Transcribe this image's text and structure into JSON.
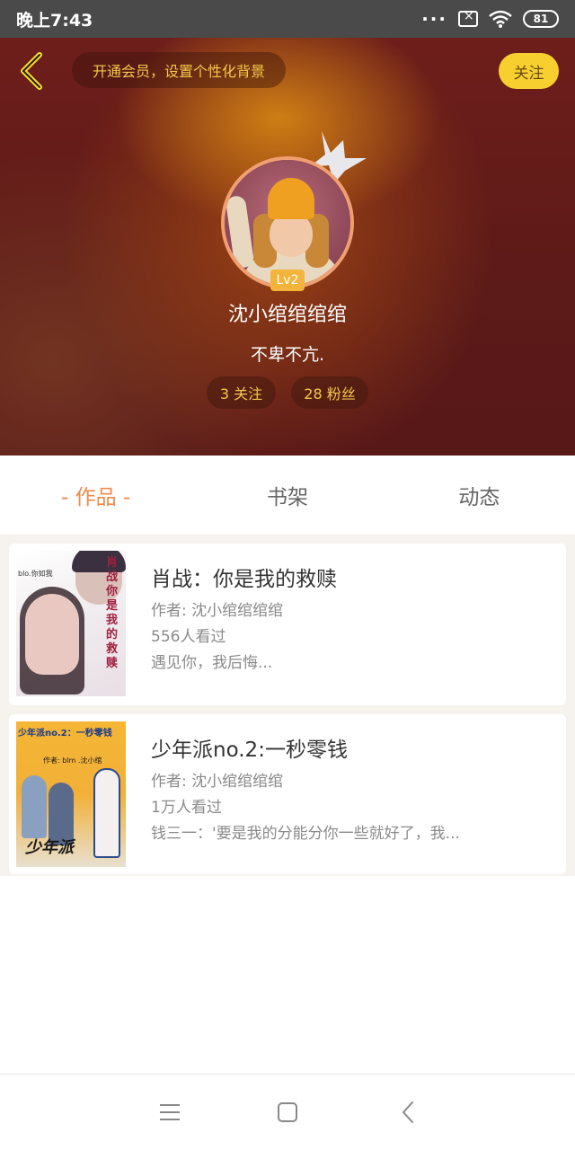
{
  "status_bar": {
    "time": "晚上7:43",
    "battery": "81"
  },
  "header": {
    "vip_prompt": "开通会员，设置个性化背景",
    "follow_label": "关注",
    "level": "Lv2",
    "username": "沈小绾绾绾绾",
    "bio": "不卑不亢.",
    "following": "3 关注",
    "fans": "28 粉丝"
  },
  "tabs": [
    {
      "label": "- 作品 -",
      "active": true
    },
    {
      "label": "书架",
      "active": false
    },
    {
      "label": "动态",
      "active": false
    }
  ],
  "works": [
    {
      "title": "肖战：你是我的救赎",
      "author": "作者: 沈小绾绾绾绾",
      "views": "556人看过",
      "desc": "遇见你，我后悔...",
      "cover_text": "肖战你是我的救赎",
      "cover_small": "blo.你如我"
    },
    {
      "title": "少年派no.2:一秒零钱",
      "author": "作者: 沈小绾绾绾绾",
      "views": "1万人看过",
      "desc": "钱三一：'要是我的分能分你一些就好了，我...",
      "cover_text": "少年派no.2：一秒零钱",
      "cover_sub": "作者: blm .沈小绾",
      "cover_logo": "少年派"
    }
  ],
  "icons": {
    "back": "chevron-left-icon",
    "crown": "crown-icon",
    "nav_menu": "menu-icon",
    "nav_home": "square-home-icon",
    "nav_back": "chevron-left-icon"
  },
  "colors": {
    "accent": "#f08a4a",
    "gold": "#f5c84a",
    "follow_bg": "#f7d030"
  }
}
